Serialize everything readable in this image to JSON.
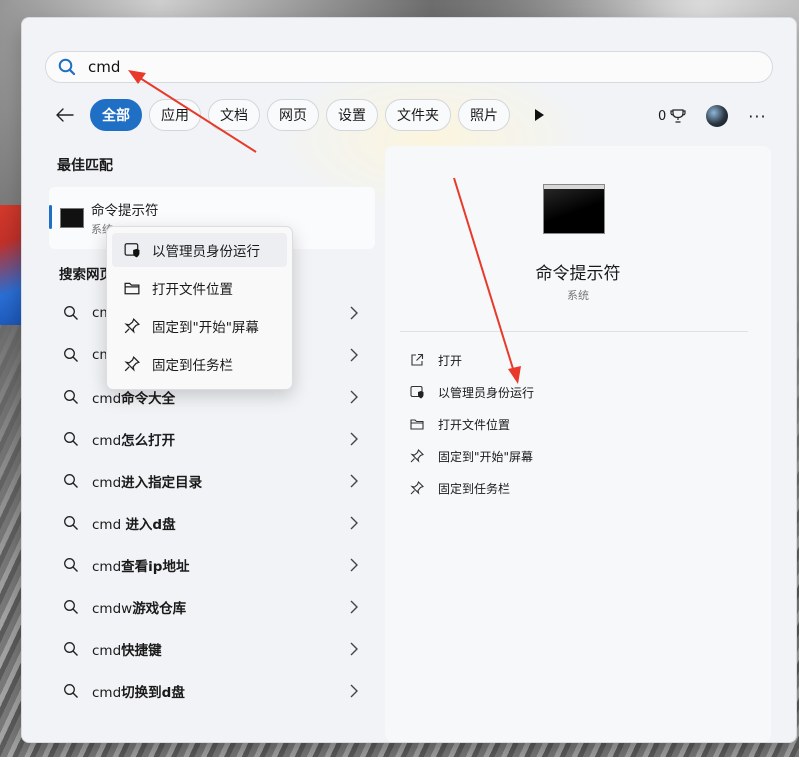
{
  "search": {
    "value": "cmd"
  },
  "filters": [
    {
      "label": "全部",
      "active": true
    },
    {
      "label": "应用",
      "active": false
    },
    {
      "label": "文档",
      "active": false
    },
    {
      "label": "网页",
      "active": false
    },
    {
      "label": "设置",
      "active": false
    },
    {
      "label": "文件夹",
      "active": false
    },
    {
      "label": "照片",
      "active": false
    }
  ],
  "rewards": {
    "count": "0"
  },
  "best_match": {
    "section_label": "最佳匹配",
    "name": "命令提示符",
    "type": "系统"
  },
  "web": {
    "section_label": "搜索网页",
    "results": [
      {
        "prefix": "cmd",
        "suffix": ""
      },
      {
        "prefix": "cmd",
        "suffix": ""
      },
      {
        "prefix": "cmd",
        "suffix": "命令大全"
      },
      {
        "prefix": "cmd",
        "suffix": "怎么打开"
      },
      {
        "prefix": "cmd",
        "suffix": "进入指定目录"
      },
      {
        "prefix": "cmd ",
        "suffix": "进入d盘"
      },
      {
        "prefix": "cmd",
        "suffix": "查看ip地址"
      },
      {
        "prefix": "cmdw",
        "suffix": "游戏仓库"
      },
      {
        "prefix": "cmd",
        "suffix": "快捷键"
      },
      {
        "prefix": "cmd",
        "suffix": "切换到d盘"
      }
    ]
  },
  "context_menu": [
    {
      "label": "以管理员身份运行",
      "icon": "shield-window-icon"
    },
    {
      "label": "打开文件位置",
      "icon": "folder-icon"
    },
    {
      "label": "固定到\"开始\"屏幕",
      "icon": "pin-icon"
    },
    {
      "label": "固定到任务栏",
      "icon": "pin-icon"
    }
  ],
  "detail": {
    "title": "命令提示符",
    "subtitle": "系统",
    "actions": [
      {
        "label": "打开",
        "icon": "open-external-icon"
      },
      {
        "label": "以管理员身份运行",
        "icon": "shield-window-icon"
      },
      {
        "label": "打开文件位置",
        "icon": "folder-icon"
      },
      {
        "label": "固定到\"开始\"屏幕",
        "icon": "pin-icon"
      },
      {
        "label": "固定到任务栏",
        "icon": "pin-icon"
      }
    ]
  },
  "colors": {
    "accent": "#1f6fc5",
    "annotation_arrow": "#e8392b"
  }
}
